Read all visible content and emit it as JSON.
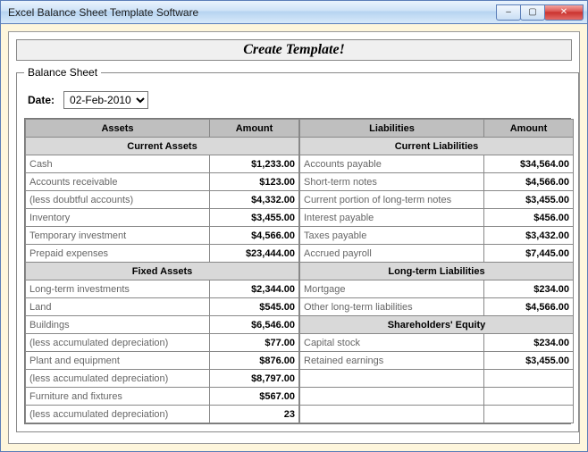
{
  "window": {
    "title": "Excel Balance Sheet Template Software",
    "min_icon": "–",
    "max_icon": "▢",
    "close_icon": "✕"
  },
  "create_button": "Create Template!",
  "fieldset_legend": "Balance Sheet",
  "date": {
    "label": "Date:",
    "value": "02-Feb-2010"
  },
  "headers": {
    "assets": "Assets",
    "amount": "Amount",
    "liabilities": "Liabilities"
  },
  "subheads": {
    "current_assets": "Current Assets",
    "fixed_assets": "Fixed Assets",
    "current_liabilities": "Current Liabilities",
    "long_term_liabilities": "Long-term Liabilities",
    "shareholders_equity": "Shareholders' Equity"
  },
  "assets": {
    "current": [
      {
        "label": "Cash",
        "amount": "$1,233.00"
      },
      {
        "label": "Accounts receivable",
        "amount": "$123.00"
      },
      {
        "label": "(less doubtful accounts)",
        "amount": "$4,332.00"
      },
      {
        "label": "Inventory",
        "amount": "$3,455.00"
      },
      {
        "label": "Temporary investment",
        "amount": "$4,566.00"
      },
      {
        "label": "Prepaid expenses",
        "amount": "$23,444.00"
      }
    ],
    "fixed": [
      {
        "label": "Long-term investments",
        "amount": "$2,344.00"
      },
      {
        "label": "Land",
        "amount": "$545.00"
      },
      {
        "label": "Buildings",
        "amount": "$6,546.00"
      },
      {
        "label": "(less accumulated depreciation)",
        "amount": "$77.00"
      },
      {
        "label": "Plant and equipment",
        "amount": "$876.00"
      },
      {
        "label": "(less accumulated depreciation)",
        "amount": "$8,797.00"
      },
      {
        "label": "Furniture and fixtures",
        "amount": "$567.00"
      },
      {
        "label": "(less accumulated depreciation)",
        "amount": "23"
      }
    ]
  },
  "liabilities": {
    "current": [
      {
        "label": "Accounts payable",
        "amount": "$34,564.00"
      },
      {
        "label": "Short-term notes",
        "amount": "$4,566.00"
      },
      {
        "label": "Current portion of long-term notes",
        "amount": "$3,455.00"
      },
      {
        "label": "Interest payable",
        "amount": "$456.00"
      },
      {
        "label": "Taxes payable",
        "amount": "$3,432.00"
      },
      {
        "label": "Accrued payroll",
        "amount": "$7,445.00"
      }
    ],
    "long_term": [
      {
        "label": "Mortgage",
        "amount": "$234.00"
      },
      {
        "label": "Other long-term liabilities",
        "amount": "$4,566.00"
      }
    ],
    "equity": [
      {
        "label": "Capital stock",
        "amount": "$234.00"
      },
      {
        "label": "Retained earnings",
        "amount": "$3,455.00"
      }
    ]
  }
}
